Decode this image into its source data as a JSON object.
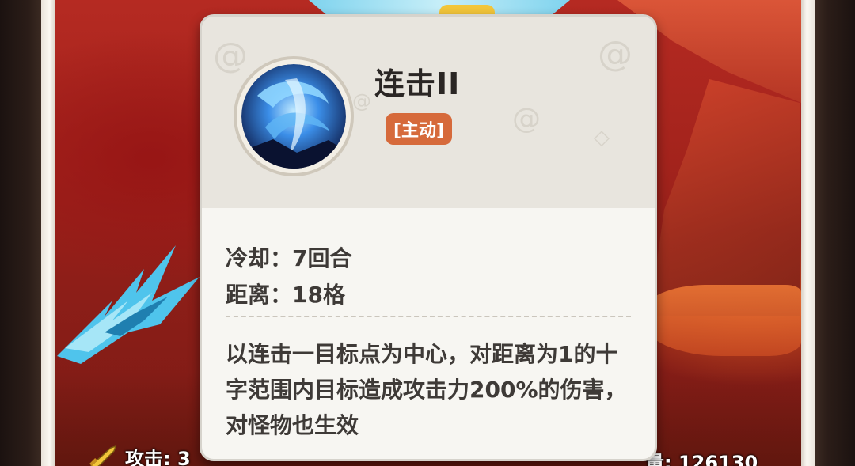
{
  "skill": {
    "title": "连击II",
    "type_tag": "[主动]",
    "cooldown": "冷却：7回合",
    "range": "距离：18格",
    "description": "以连击一目标点为中心，对距离为1的十字范围内目标造成攻击力200%的伤害，对怪物也生效",
    "icon": "blue-slash-skill-icon"
  },
  "bottom_stats": {
    "attack_partial": "攻击: 3",
    "hp_partial": "量: 126130"
  },
  "colors": {
    "tag_bg": "#d66a3b",
    "card_bg": "#f7f6f2",
    "card_head_bg": "#e8e5de",
    "text": "#3e3a37",
    "title": "#2a2624"
  }
}
